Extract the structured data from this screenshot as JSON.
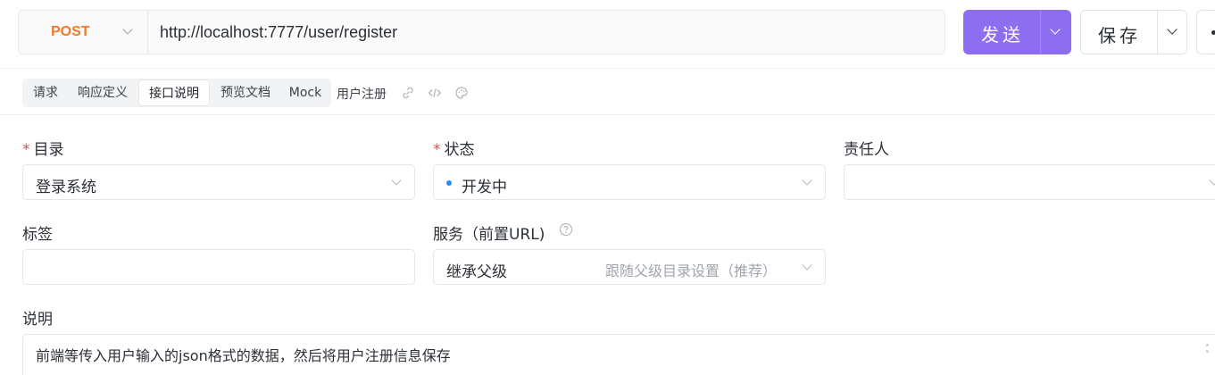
{
  "request": {
    "method": "POST",
    "url": "http://localhost:7777/user/register",
    "send_label": "发送",
    "save_label": "保存"
  },
  "tabs": [
    {
      "label": "请求",
      "active": false
    },
    {
      "label": "响应定义",
      "active": false
    },
    {
      "label": "接口说明",
      "active": true
    },
    {
      "label": "预览文档",
      "active": false
    },
    {
      "label": "Mock",
      "active": false
    }
  ],
  "api_name": "用户注册",
  "form": {
    "directory": {
      "label": "目录",
      "required": true,
      "value": "登录系统"
    },
    "status": {
      "label": "状态",
      "required": true,
      "value": "开发中",
      "dot_color": "#2f86f6"
    },
    "owner": {
      "label": "责任人",
      "value": ""
    },
    "tags": {
      "label": "标签",
      "value": ""
    },
    "service": {
      "label": "服务（前置URL)",
      "value": "继承父级",
      "hint": "跟随父级目录设置（推荐）"
    },
    "description": {
      "label": "说明",
      "value": "前端等传入用户输入的json格式的数据，然后将用户注册信息保存"
    }
  },
  "colors": {
    "accent": "#8e6ef0",
    "method_post": "#f07a2a",
    "required": "#e5484d"
  },
  "icons": [
    "link-icon",
    "code-icon",
    "palette-icon",
    "help-icon",
    "chevron-down-icon",
    "more-icon",
    "resize-icon"
  ]
}
